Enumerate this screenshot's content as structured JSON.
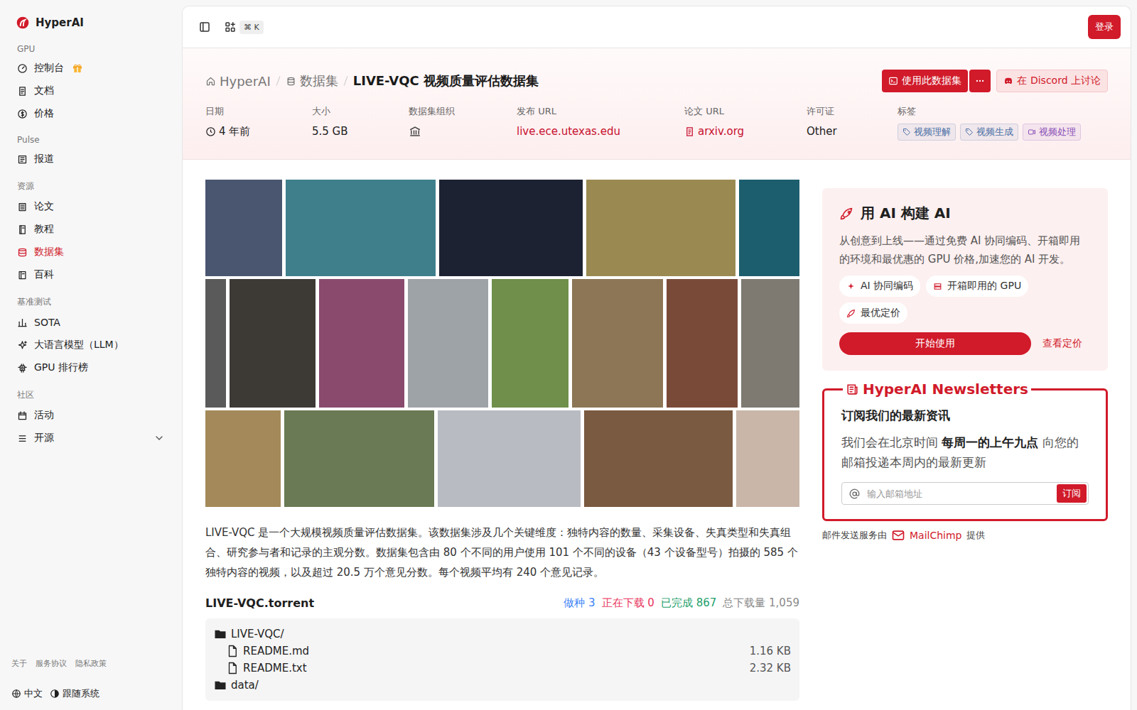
{
  "brand": {
    "name": "HyperAI"
  },
  "sidebar": {
    "sections": [
      {
        "title": "GPU",
        "items": [
          {
            "label": "控制台",
            "selected": false,
            "kind": "gift"
          },
          {
            "label": "文档",
            "selected": false,
            "kind": "plain"
          },
          {
            "label": "价格",
            "selected": false,
            "kind": "plain"
          }
        ]
      },
      {
        "title": "Pulse",
        "items": [
          {
            "label": "报道",
            "selected": false,
            "kind": "plain"
          }
        ]
      },
      {
        "title": "资源",
        "items": [
          {
            "label": "论文",
            "selected": false,
            "kind": "plain"
          },
          {
            "label": "教程",
            "selected": false,
            "kind": "plain"
          },
          {
            "label": "数据集",
            "selected": true,
            "kind": "plain"
          },
          {
            "label": "百科",
            "selected": false,
            "kind": "plain"
          }
        ]
      },
      {
        "title": "基准测试",
        "items": [
          {
            "label": "SOTA",
            "selected": false,
            "kind": "plain"
          },
          {
            "label": "大语言模型（LLM）",
            "selected": false,
            "kind": "plain"
          },
          {
            "label": "GPU 排行榜",
            "selected": false,
            "kind": "plain"
          }
        ]
      },
      {
        "title": "社区",
        "items": [
          {
            "label": "活动",
            "selected": false,
            "kind": "plain"
          },
          {
            "label": "开源",
            "selected": false,
            "kind": "expandable",
            "expanded": false
          }
        ]
      }
    ],
    "footer_links": [
      "关于",
      "服务协议",
      "隐私政策"
    ],
    "language": "中文",
    "theme": "跟随系统"
  },
  "topbar": {
    "shortcut": "⌘ K",
    "login": "登录"
  },
  "breadcrumb": [
    "HyperAI",
    "数据集",
    "LIVE-VQC 视频质量评估数据集"
  ],
  "actions": {
    "use": "使用此数据集",
    "discord": "在 Discord 上讨论"
  },
  "meta": [
    {
      "label": "日期",
      "value": "4 年前",
      "kind": "time"
    },
    {
      "label": "大小",
      "value": "5.5 GB",
      "kind": "text"
    },
    {
      "label": "数据集组织",
      "value": "",
      "kind": "org"
    },
    {
      "label": "发布 URL",
      "value": "live.ece.utexas.edu",
      "kind": "link"
    },
    {
      "label": "论文 URL",
      "value": "arxiv.org",
      "kind": "paper"
    },
    {
      "label": "许可证",
      "value": "Other",
      "kind": "text"
    },
    {
      "label": "标签",
      "value": "",
      "kind": "tags"
    }
  ],
  "tags": [
    {
      "label": "视频理解",
      "kind": "tag",
      "color": "#4a6fa5"
    },
    {
      "label": "视频生成",
      "kind": "tag",
      "color": "#4a6fa5"
    },
    {
      "label": "视频处理",
      "kind": "video",
      "color": "#8a4fb8"
    }
  ],
  "description": "LIVE-VQC 是一个大规模视频质量评估数据集。该数据集涉及几个关键维度：独特内容的数量、采集设备、失真类型和失真组合、研究参与者和记录的主观分数。数据集包含由 80 个不同的用户使用 101 个不同的设备（43 个设备型号）拍摄的 585 个独特内容的视频，以及超过 20.5 万个意见分数。每个视频平均有 240 个意见记录。",
  "torrent": {
    "name": "LIVE-VQC.torrent",
    "stats": [
      {
        "label": "做种",
        "value": "3",
        "color": "#3b82f6"
      },
      {
        "label": "正在下载",
        "value": "0",
        "color": "#e8365d"
      },
      {
        "label": "已完成",
        "value": "867",
        "color": "#22a06b"
      },
      {
        "label": "总下载量",
        "value": "1,059",
        "color": "#8a8a8a"
      }
    ],
    "files": [
      {
        "name": "LIVE-VQC/",
        "kind": "folder",
        "children": [
          {
            "name": "README.md",
            "size": "1.16 KB",
            "kind": "file"
          },
          {
            "name": "README.txt",
            "size": "2.32 KB",
            "kind": "file"
          }
        ]
      },
      {
        "name": "data/",
        "kind": "folder",
        "children": []
      }
    ]
  },
  "promo": {
    "title": "用 AI 构建 AI",
    "text": "从创意到上线——通过免费 AI 协同编码、开箱即用的环境和最优惠的 GPU 价格,加速您的 AI 开发。",
    "features": [
      "AI 协同编码",
      "开箱即用的 GPU",
      "最优定价"
    ],
    "primary": "开始使用",
    "secondary": "查看定价"
  },
  "newsletter": {
    "title": "HyperAI Newsletters",
    "heading": "订阅我们的最新资讯",
    "text_before": "我们会在北京时间 ",
    "text_bold": "每周一的上午九点",
    "text_after": " 向您的邮箱投递本周内的最新更新",
    "placeholder": "输入邮箱地址",
    "button": "订阅",
    "provider_before": "邮件发送服务由",
    "provider": "MailChimp",
    "provider_after": "提供"
  }
}
